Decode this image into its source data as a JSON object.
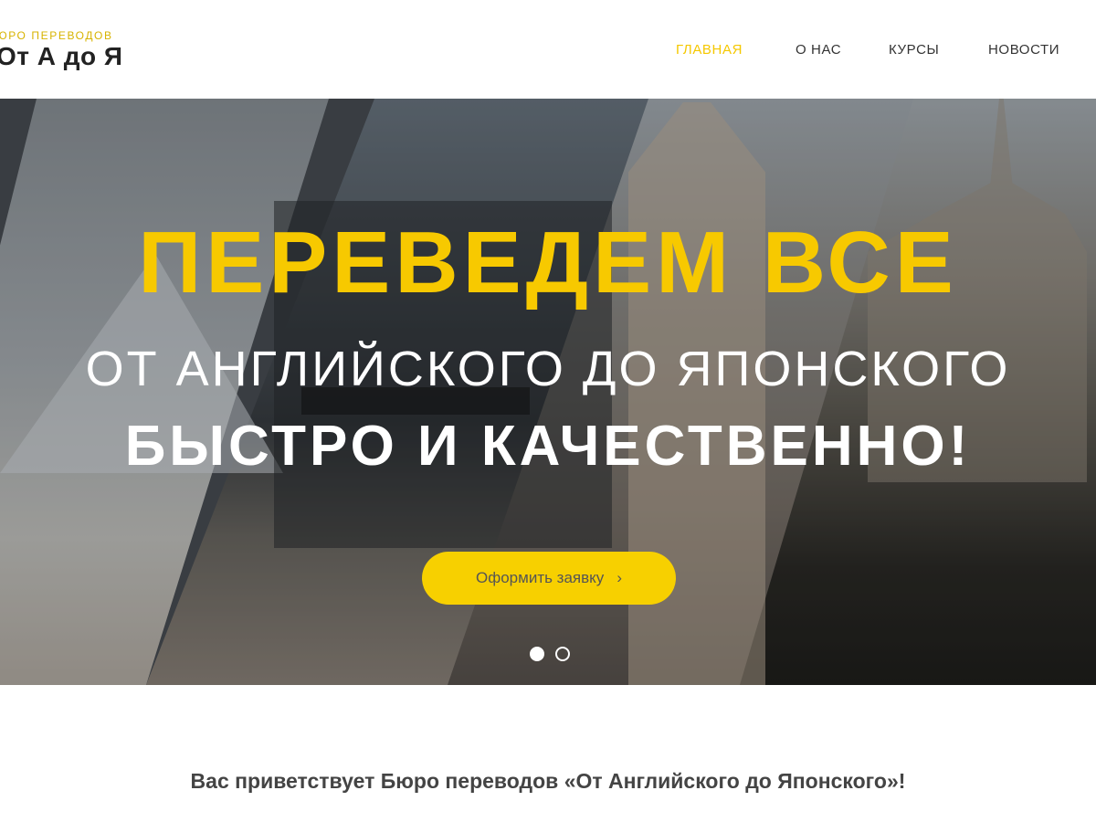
{
  "header": {
    "logo_tagline": "БЮРО ПЕРЕВОДОВ",
    "logo_name": "От А до Я"
  },
  "nav": {
    "items": [
      {
        "label": "ГЛАВНАЯ",
        "active": true
      },
      {
        "label": "О НАС",
        "active": false
      },
      {
        "label": "КУРСЫ",
        "active": false
      },
      {
        "label": "НОВОСТИ",
        "active": false
      }
    ]
  },
  "hero": {
    "title": "ПЕРЕВЕДЕМ ВСЕ",
    "subtitle_1": "ОТ АНГЛИЙСКОГО ДО ЯПОНСКОГО",
    "subtitle_2": "БЫСТРО И КАЧЕСТВЕННО!",
    "cta_label": "Оформить заявку",
    "cta_arrow": "›",
    "slides_count": 2,
    "active_slide": 1
  },
  "welcome": {
    "text": "Вас приветствует Бюро переводов «От Английского до Японского»!"
  },
  "colors": {
    "accent": "#f7c900",
    "text_dark": "#333333",
    "text_white": "#ffffff"
  }
}
